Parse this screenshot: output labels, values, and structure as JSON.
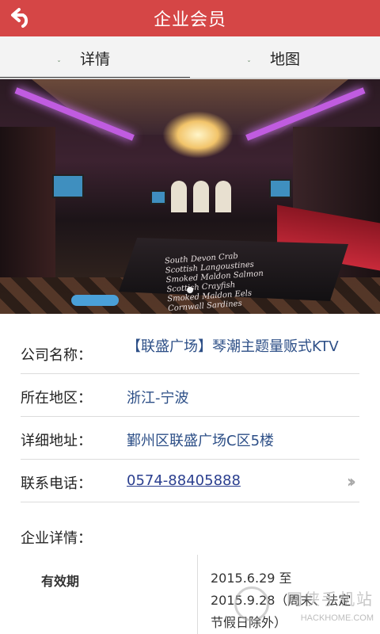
{
  "header": {
    "title": "企业会员"
  },
  "tabs": [
    {
      "label": "详情",
      "active": true
    },
    {
      "label": "地图",
      "active": false
    }
  ],
  "photo": {
    "menu_lines": [
      "South Devon Crab",
      "Scottish Langoustines",
      "Smoked Maldon Salmon",
      "Scottish Crayfish",
      "Smoked Maldon Eels",
      "Cornwall Sardines"
    ]
  },
  "info": {
    "company_label": "公司名称：",
    "company_value": "【联盛广场】琴潮主题量贩式KTV",
    "region_label": "所在地区：",
    "region_value": "浙江-宁波",
    "address_label": "详细地址：",
    "address_value": "鄞州区联盛广场C区5楼",
    "phone_label": "联系电话：",
    "phone_value": "0574-88405888",
    "detail_label": "企业详情："
  },
  "validity": {
    "label": "有效期",
    "value": "2015.6.29 至 2015.9.28（周末、法定节假日除外）"
  },
  "watermark": {
    "title": "网侠手机站",
    "url": "HACKHOME.COM"
  },
  "colors": {
    "header": "#d54646",
    "link": "#2d4f87"
  }
}
